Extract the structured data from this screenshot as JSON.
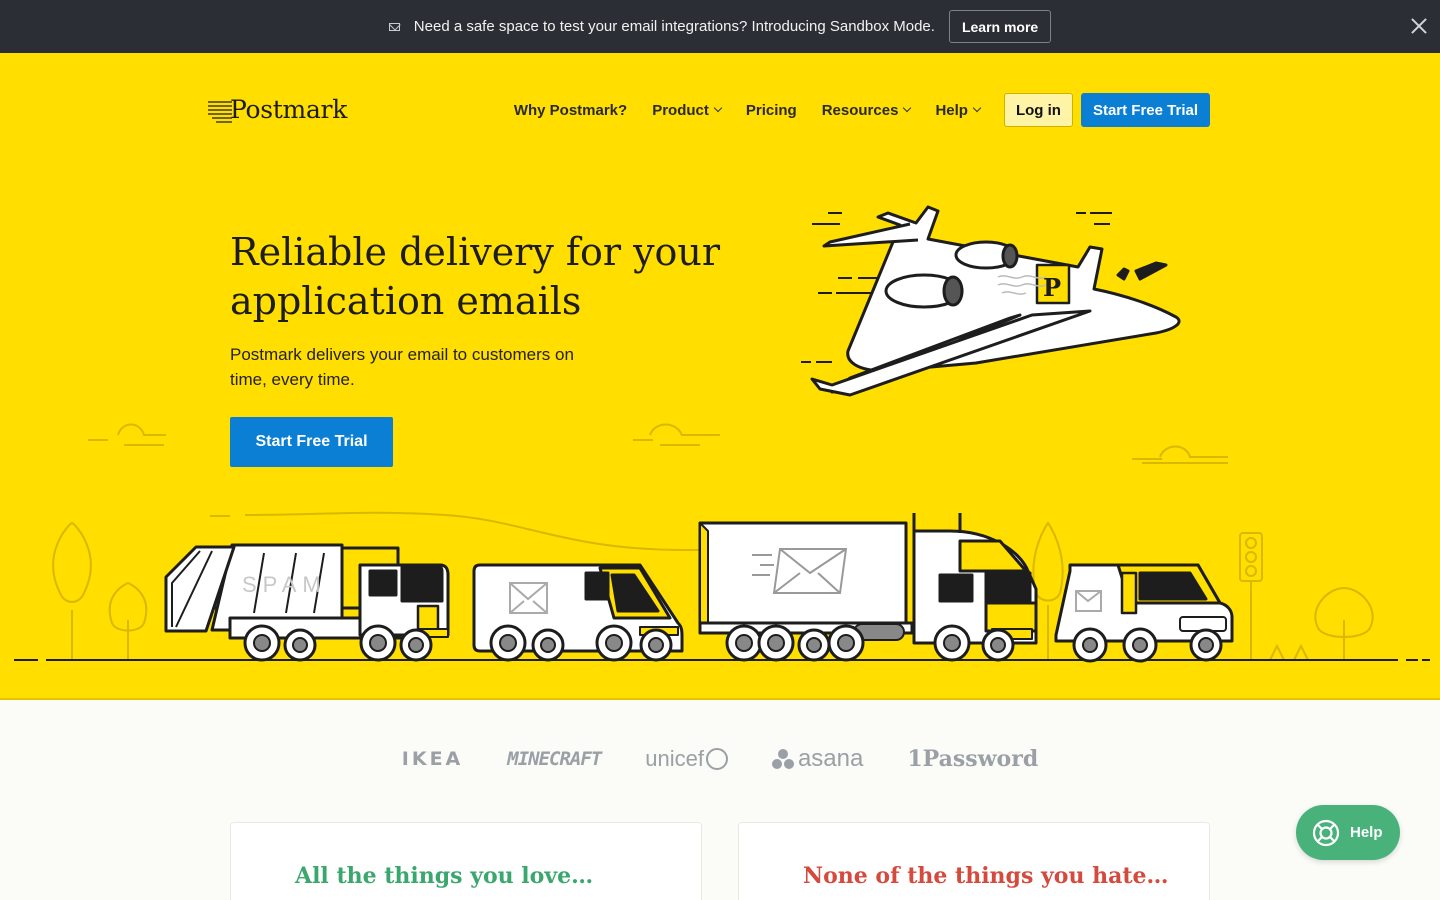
{
  "announcement": {
    "text": "Need a safe space to test your email integrations? Introducing Sandbox Mode.",
    "learn_more": "Learn more"
  },
  "header": {
    "logo_text": "Postmark",
    "nav": [
      {
        "label": "Why Postmark?",
        "dropdown": false
      },
      {
        "label": "Product",
        "dropdown": true
      },
      {
        "label": "Pricing",
        "dropdown": false
      },
      {
        "label": "Resources",
        "dropdown": true
      },
      {
        "label": "Help",
        "dropdown": true
      }
    ],
    "login": "Log in",
    "cta": "Start Free Trial"
  },
  "hero": {
    "title": "Reliable delivery for your application emails",
    "subtitle": "Postmark delivers your email to customers on time, every time.",
    "cta": "Start Free Trial",
    "truck_label": "SPAM",
    "plane_badge": "P"
  },
  "clients": [
    "IKEA",
    "MINECRAFT",
    "unicef",
    "asana",
    "1Password"
  ],
  "cards": {
    "left_title": "All the things you love…",
    "right_title": "None of the things you hate…"
  },
  "help_widget": {
    "label": "Help"
  },
  "colors": {
    "hero_bg": "#ffde00",
    "primary": "#0a7fd4",
    "announcement_bg": "#2b2f35",
    "love": "#3aa76d",
    "hate": "#d44a3c",
    "help": "#48b27a"
  }
}
